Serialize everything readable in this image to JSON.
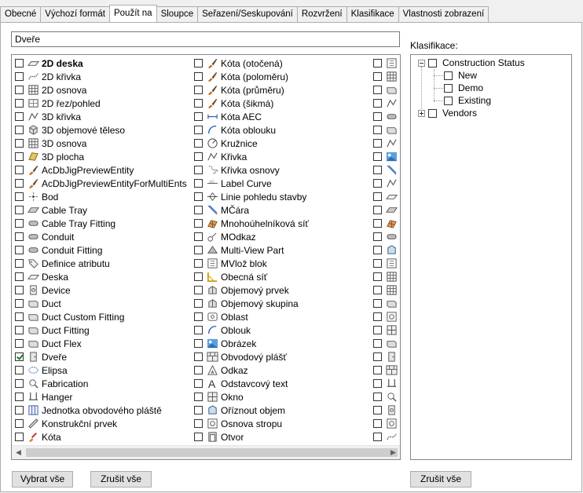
{
  "tabs": [
    {
      "label": "Obecné",
      "active": false
    },
    {
      "label": "Výchozí formát",
      "active": false
    },
    {
      "label": "Použít na",
      "active": true
    },
    {
      "label": "Sloupce",
      "active": false
    },
    {
      "label": "Seřazení/Seskupování",
      "active": false
    },
    {
      "label": "Rozvržení",
      "active": false
    },
    {
      "label": "Klasifikace",
      "active": false
    },
    {
      "label": "Vlastnosti zobrazení",
      "active": false
    }
  ],
  "filter": {
    "value": "Dveře"
  },
  "columns": [
    [
      {
        "label": "2D deska",
        "icon": "2d-deska-icon",
        "checked": false,
        "bold": true
      },
      {
        "label": "2D křivka",
        "icon": "2d-krivka-icon",
        "checked": false
      },
      {
        "label": "2D osnova",
        "icon": "2d-osnova-icon",
        "checked": false
      },
      {
        "label": "2D řez/pohled",
        "icon": "2d-rez-pohled-icon",
        "checked": false
      },
      {
        "label": "3D křivka",
        "icon": "3d-krivka-icon",
        "checked": false
      },
      {
        "label": "3D objemové těleso",
        "icon": "3d-teleso-icon",
        "checked": false
      },
      {
        "label": "3D osnova",
        "icon": "3d-osnova-icon",
        "checked": false
      },
      {
        "label": "3D plocha",
        "icon": "3d-plocha-icon",
        "checked": false
      },
      {
        "label": "AcDbJigPreviewEntity",
        "icon": "brush-icon",
        "checked": false
      },
      {
        "label": "AcDbJigPreviewEntityForMultiEnts",
        "icon": "brush-icon",
        "checked": false
      },
      {
        "label": "Bod",
        "icon": "bod-icon",
        "checked": false
      },
      {
        "label": "Cable Tray",
        "icon": "cable-tray-icon",
        "checked": false
      },
      {
        "label": "Cable Tray Fitting",
        "icon": "cable-tray-fitting-icon",
        "checked": false
      },
      {
        "label": "Conduit",
        "icon": "conduit-icon",
        "checked": false
      },
      {
        "label": "Conduit Fitting",
        "icon": "conduit-fitting-icon",
        "checked": false
      },
      {
        "label": "Definice atributu",
        "icon": "definice-atributu-icon",
        "checked": false
      },
      {
        "label": "Deska",
        "icon": "deska-icon",
        "checked": false
      },
      {
        "label": "Device",
        "icon": "device-icon",
        "checked": false
      },
      {
        "label": "Duct",
        "icon": "duct-icon",
        "checked": false
      },
      {
        "label": "Duct Custom Fitting",
        "icon": "duct-custom-fitting-icon",
        "checked": false
      },
      {
        "label": "Duct Fitting",
        "icon": "duct-fitting-icon",
        "checked": false
      },
      {
        "label": "Duct Flex",
        "icon": "duct-flex-icon",
        "checked": false
      },
      {
        "label": "Dveře",
        "icon": "dvere-icon",
        "checked": true
      },
      {
        "label": "Elipsa",
        "icon": "elipsa-icon",
        "checked": false
      },
      {
        "label": "Fabrication",
        "icon": "fabrication-icon",
        "checked": false
      },
      {
        "label": "Hanger",
        "icon": "hanger-icon",
        "checked": false
      },
      {
        "label": "Jednotka obvodového pláště",
        "icon": "jednotka-plaste-icon",
        "checked": false
      },
      {
        "label": "Konstrukční prvek",
        "icon": "konstrukcni-prvek-icon",
        "checked": false
      },
      {
        "label": "Kóta",
        "icon": "kota-icon",
        "checked": false
      }
    ],
    [
      {
        "label": "Kóta (otočená)",
        "icon": "brush-icon",
        "checked": false
      },
      {
        "label": "Kóta (poloměru)",
        "icon": "brush-icon",
        "checked": false
      },
      {
        "label": "Kóta (průměru)",
        "icon": "brush-icon",
        "checked": false
      },
      {
        "label": "Kóta (šikmá)",
        "icon": "brush-icon",
        "checked": false
      },
      {
        "label": "Kóta AEC",
        "icon": "kota-aec-icon",
        "checked": false
      },
      {
        "label": "Kóta oblouku",
        "icon": "kota-oblouku-icon",
        "checked": false
      },
      {
        "label": "Kružnice",
        "icon": "kruznice-icon",
        "checked": false
      },
      {
        "label": "Křivka",
        "icon": "krivka-icon",
        "checked": false
      },
      {
        "label": "Křivka osnovy",
        "icon": "krivka-osnovy-icon",
        "checked": false
      },
      {
        "label": "Label Curve",
        "icon": "label-curve-icon",
        "checked": false
      },
      {
        "label": "Linie pohledu stavby",
        "icon": "linie-pohledu-icon",
        "checked": false
      },
      {
        "label": "MČára",
        "icon": "mcara-icon",
        "checked": false
      },
      {
        "label": "Mnohoúhelníková síť",
        "icon": "mnohouhelnikova-sit-icon",
        "checked": false
      },
      {
        "label": "MOdkaz",
        "icon": "modkaz-icon",
        "checked": false
      },
      {
        "label": "Multi-View Part",
        "icon": "multi-view-part-icon",
        "checked": false
      },
      {
        "label": "MVlož blok",
        "icon": "mvloz-blok-icon",
        "checked": false
      },
      {
        "label": "Obecná síť",
        "icon": "obecna-sit-icon",
        "checked": false
      },
      {
        "label": "Objemový prvek",
        "icon": "objemovy-prvek-icon",
        "checked": false
      },
      {
        "label": "Objemový skupina",
        "icon": "objemova-skupina-icon",
        "checked": false
      },
      {
        "label": "Oblast",
        "icon": "oblast-icon",
        "checked": false
      },
      {
        "label": "Oblouk",
        "icon": "oblouk-icon",
        "checked": false
      },
      {
        "label": "Obrázek",
        "icon": "obrazek-icon",
        "checked": false
      },
      {
        "label": "Obvodový plášť",
        "icon": "obvodovy-plast-icon",
        "checked": false
      },
      {
        "label": "Odkaz",
        "icon": "odkaz-icon",
        "checked": false
      },
      {
        "label": "Odstavcový text",
        "icon": "odstavcovy-text-icon",
        "checked": false
      },
      {
        "label": "Okno",
        "icon": "okno-icon",
        "checked": false
      },
      {
        "label": "Oříznout objem",
        "icon": "oriznout-objem-icon",
        "checked": false
      },
      {
        "label": "Osnova stropu",
        "icon": "osnova-stropu-icon",
        "checked": false
      },
      {
        "label": "Otvor",
        "icon": "otvor-icon",
        "checked": false
      }
    ],
    [
      {
        "label": "",
        "icon": "c3-icon-1",
        "checked": false
      },
      {
        "label": "",
        "icon": "c3-icon-2",
        "checked": false
      },
      {
        "label": "",
        "icon": "c3-icon-3",
        "checked": false
      },
      {
        "label": "",
        "icon": "c3-icon-4",
        "checked": false
      },
      {
        "label": "",
        "icon": "c3-icon-5",
        "checked": false
      },
      {
        "label": "",
        "icon": "c3-icon-6",
        "checked": false
      },
      {
        "label": "",
        "icon": "c3-icon-7",
        "checked": false
      },
      {
        "label": "",
        "icon": "c3-icon-8",
        "checked": false
      },
      {
        "label": "",
        "icon": "c3-icon-9",
        "checked": false
      },
      {
        "label": "",
        "icon": "c3-icon-10",
        "checked": false
      },
      {
        "label": "",
        "icon": "c3-icon-11",
        "checked": false
      },
      {
        "label": "",
        "icon": "c3-icon-12",
        "checked": false
      },
      {
        "label": "",
        "icon": "c3-icon-13",
        "checked": false
      },
      {
        "label": "",
        "icon": "c3-icon-14",
        "checked": false
      },
      {
        "label": "",
        "icon": "c3-icon-15",
        "checked": false
      },
      {
        "label": "",
        "icon": "c3-icon-16",
        "checked": false
      },
      {
        "label": "",
        "icon": "c3-icon-17",
        "checked": false
      },
      {
        "label": "",
        "icon": "c3-icon-18",
        "checked": false
      },
      {
        "label": "",
        "icon": "c3-icon-19",
        "checked": false
      },
      {
        "label": "",
        "icon": "c3-icon-20",
        "checked": false
      },
      {
        "label": "",
        "icon": "c3-icon-21",
        "checked": false
      },
      {
        "label": "",
        "icon": "c3-icon-22",
        "checked": false
      },
      {
        "label": "",
        "icon": "c3-icon-23",
        "checked": false
      },
      {
        "label": "",
        "icon": "c3-icon-24",
        "checked": false
      },
      {
        "label": "",
        "icon": "c3-icon-25",
        "checked": false
      },
      {
        "label": "",
        "icon": "c3-icon-26",
        "checked": false
      },
      {
        "label": "",
        "icon": "c3-icon-27",
        "checked": false
      },
      {
        "label": "",
        "icon": "c3-icon-28",
        "checked": false
      },
      {
        "label": "",
        "icon": "c3-icon-29",
        "checked": false
      }
    ]
  ],
  "klasifikace": {
    "label": "Klasifikace:",
    "tree": [
      {
        "label": "Construction Status",
        "expanded": true,
        "children": [
          {
            "label": "New"
          },
          {
            "label": "Demo"
          },
          {
            "label": "Existing"
          }
        ]
      },
      {
        "label": "Vendors",
        "expanded": false
      }
    ]
  },
  "buttons": {
    "select_all": "Vybrat vše",
    "deselect_all": "Zrušit vše",
    "klas_deselect": "Zrušit vše"
  }
}
